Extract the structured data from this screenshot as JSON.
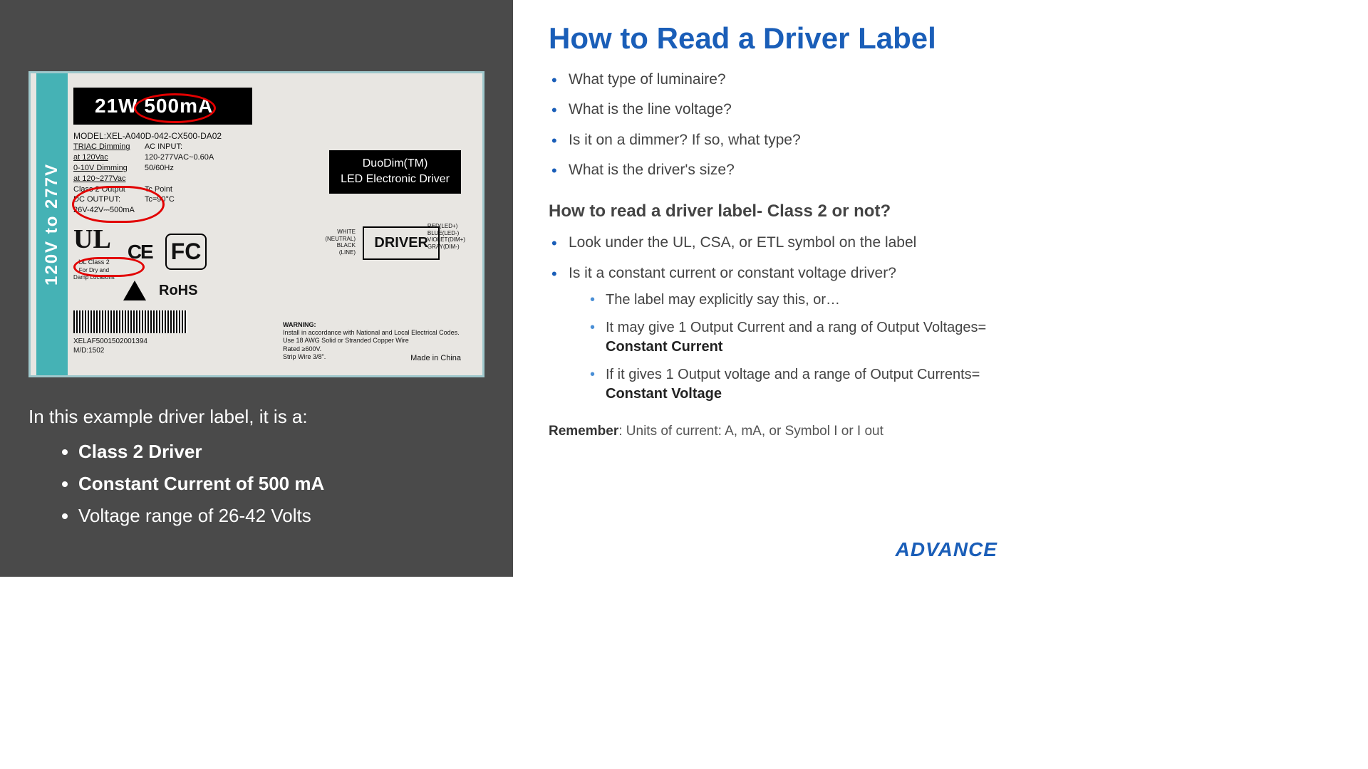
{
  "left": {
    "photo": {
      "side_voltage": "120V to 277V",
      "top_black": "21W 500mA",
      "model": "MODEL:XEL-A040D-042-CX500-DA02",
      "triac": "TRIAC Dimming",
      "at120": "at 120Vac",
      "dim010": "0-10V Dimming",
      "at120277": "at 120~277Vac",
      "acinput_lbl": "AC INPUT:",
      "acinput_val": "120-277VAC~0.60A",
      "freq": "50/60Hz",
      "class2out": "Class 2 Output",
      "dcout_lbl": "DC OUTPUT:",
      "dcout_val": "26V-42V⎓500mA",
      "tcpoint": "Tc Point",
      "tc90": "Tc=90°C",
      "ulclass2": "UL Class 2",
      "dry_damp": "For Dry and\nDamp Locations",
      "duodim1": "DuoDim(TM)",
      "duodim2": "LED Electronic Driver",
      "driver": "DRIVER",
      "pins_left": "WHITE\n(NEUTRAL)\nBLACK\n(LINE)",
      "pins_right": "RED(LED+)\nBLUE(LED-)\nVIOLET(DIM+)\nGRAY(DIM-)",
      "rohs": "RoHS",
      "warning_h": "WARNING:",
      "warning_body": "Install in accordance with National and Local Electrical Codes.\nUse 18 AWG Solid or Stranded Copper Wire\nRated ≥600V.\nStrip Wire 3/8\".",
      "made_in": "Made in China",
      "barcode_num": "XELAF5001502001394",
      "md": "M/D:1502"
    },
    "caption_intro": "In this example driver label, it is a:",
    "caption_items": [
      {
        "text": "Class 2 Driver",
        "bold": true
      },
      {
        "text": "Constant Current of 500 mA",
        "bold": true
      },
      {
        "text": "Voltage range of 26-42 Volts",
        "bold": false
      }
    ]
  },
  "right": {
    "title": "How to Read a Driver Label",
    "questions": [
      "What type of luminaire?",
      "What is the line voltage?",
      "Is it on a dimmer? If so, what type?",
      "What is the driver's size?"
    ],
    "sub_heading": "How to read a driver label- Class 2 or not?",
    "sub_items": [
      "Look under the UL, CSA, or ETL symbol on the label",
      "Is it a constant current or constant voltage driver?"
    ],
    "sub_sub": {
      "a": "The label may explicitly say this, or…",
      "b_pre": "It may give 1 Output Current and a rang of Output Voltages= ",
      "b_bold": "Constant Current",
      "c_pre": "If it gives 1 Output voltage and a range of Output Currents= ",
      "c_bold": "Constant Voltage"
    },
    "remember_label": "Remember",
    "remember_text": ": Units of current: A, mA, or Symbol I or I out",
    "brand": "ADVANCE"
  }
}
